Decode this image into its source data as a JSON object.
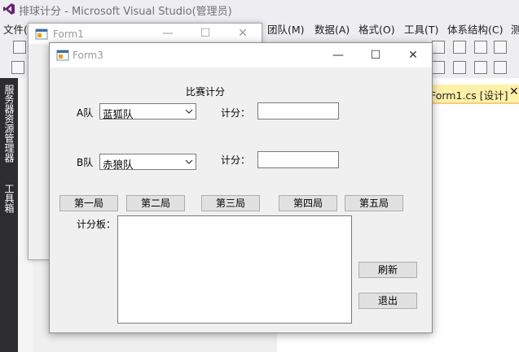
{
  "ide": {
    "title": "排球计分 - Microsoft Visual Studio(管理员)",
    "menu": [
      "文件(",
      "团队(M)",
      "数据(A)",
      "格式(O)",
      "工具(T)",
      "体系结构(C)",
      "测"
    ],
    "side_tabs": [
      "服务器资源管理器",
      "工具箱"
    ],
    "doc_tab": "Form1.cs [设计]",
    "doc_tab_close": "✕"
  },
  "form1": {
    "title": "Form1",
    "min_glyph": "—",
    "max_glyph": "☐",
    "close_glyph": "✕"
  },
  "form3": {
    "title": "Form3",
    "min_glyph": "—",
    "max_glyph": "☐",
    "close_glyph": "✕",
    "heading": "比赛计分",
    "team_a_label": "A队",
    "team_a_value": "蓝狐队",
    "team_a_score_label": "计分：",
    "team_b_label": "B队",
    "team_b_value": "赤狼队",
    "team_b_score_label": "计分：",
    "rounds": [
      "第一局",
      "第二局",
      "第三局",
      "第四局",
      "第五局"
    ],
    "scoreboard_label": "计分板：",
    "refresh_label": "刷新",
    "exit_label": "退出"
  },
  "colors": {
    "ide_bg": "#eeeef2",
    "rail": "#2d2d30",
    "doc_tab": "#fff1a8",
    "form_bg": "#f0f0f0",
    "button_bg": "#e1e1e1"
  }
}
